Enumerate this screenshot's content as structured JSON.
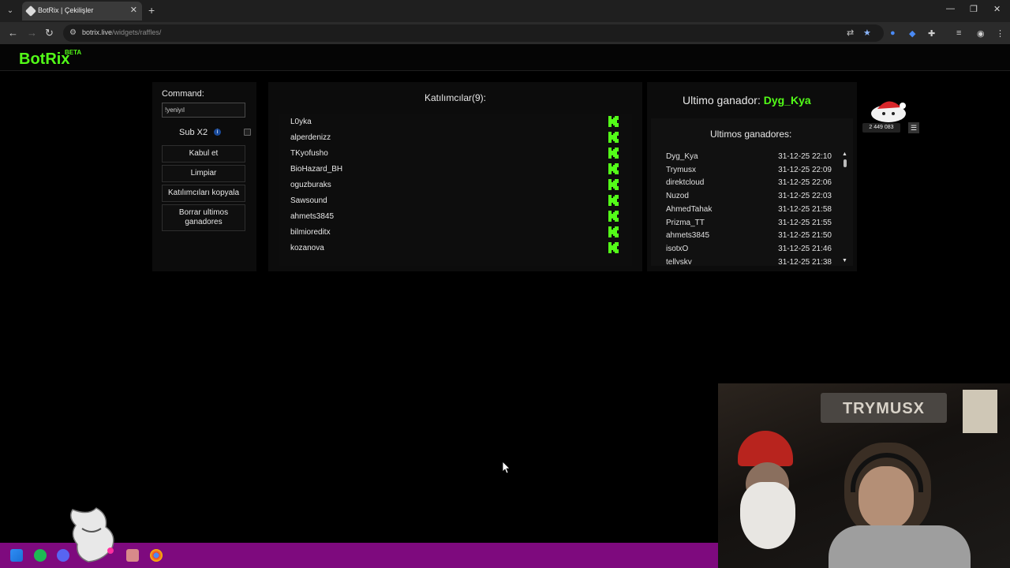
{
  "browser": {
    "tab_title": "BotRix | Çekilişler",
    "url_host": "botrix.live",
    "url_path": "/widgets/raffles/"
  },
  "site": {
    "logo": "BotRix",
    "logo_badge": "BETA"
  },
  "controls": {
    "command_label": "Command:",
    "command_value": "!yeniyıl",
    "sub_label": "Sub X2",
    "sub_checked": false,
    "buttons": [
      "Kabul et",
      "Limpiar",
      "Katılımcıları kopyala",
      "Borrar ultimos ganadores"
    ]
  },
  "participants": {
    "title": "Katılımcılar(9):",
    "items": [
      "L0yka",
      "alperdenizz",
      "TKyofusho",
      "BioHazard_BH",
      "oguzburaks",
      "Sawsound",
      "ahmets3845",
      "bilmioreditx",
      "kozanova"
    ]
  },
  "winner": {
    "label": "Ultimo ganador:",
    "name": "Dyg_Kya"
  },
  "last_winners": {
    "title": "Ultimos ganadores:",
    "items": [
      {
        "name": "Dyg_Kya",
        "date": "31-12-25 22:10"
      },
      {
        "name": "Trymusx",
        "date": "31-12-25 22:09"
      },
      {
        "name": "direktcloud",
        "date": "31-12-25 22:06"
      },
      {
        "name": "Nuzod",
        "date": "31-12-25 22:03"
      },
      {
        "name": "AhmedTahak",
        "date": "31-12-25 21:58"
      },
      {
        "name": "Prizma_TT",
        "date": "31-12-25 21:55"
      },
      {
        "name": "ahmets3845",
        "date": "31-12-25 21:50"
      },
      {
        "name": "isotxO",
        "date": "31-12-25 21:46"
      },
      {
        "name": "tellysky",
        "date": "31-12-25 21:38"
      }
    ]
  },
  "overlay": {
    "counter": "2 449 083",
    "webcam_banner": "TRYMUSX"
  },
  "colors": {
    "accent": "#53fc18",
    "taskbar": "#7e0a7e"
  }
}
